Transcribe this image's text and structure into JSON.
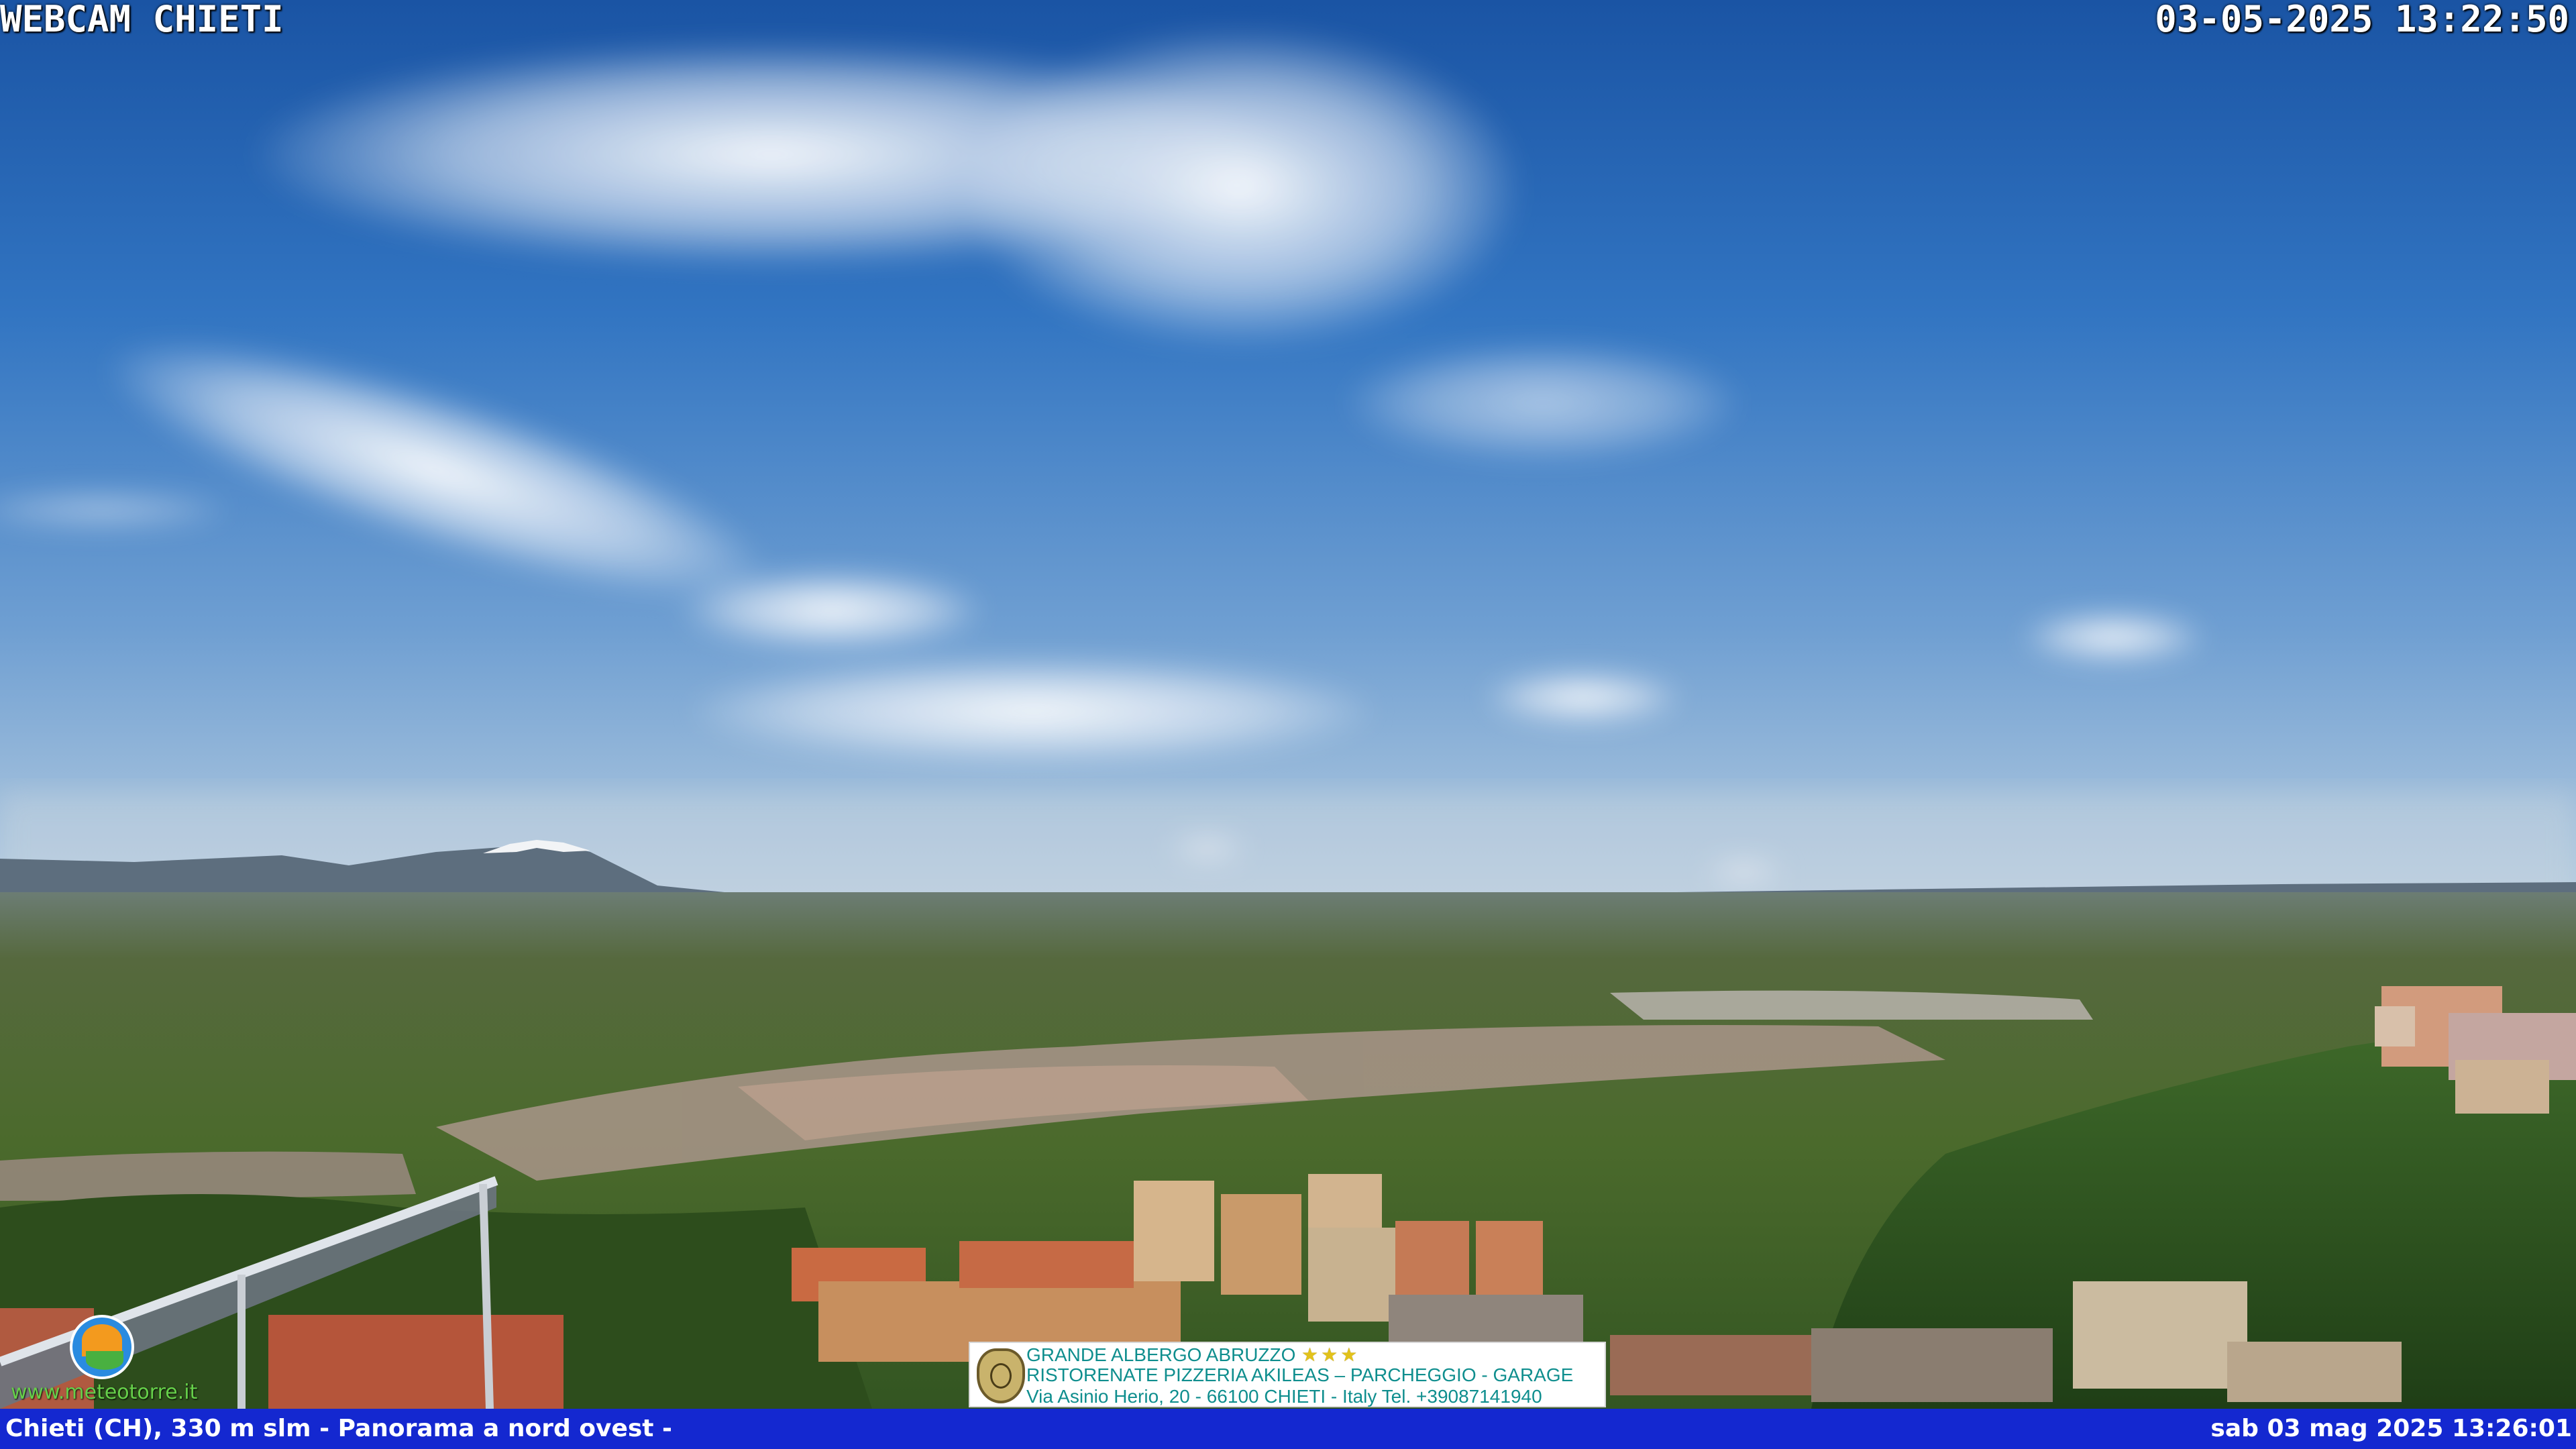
{
  "overlay": {
    "title": "WEBCAM CHIETI",
    "timestamp": "03-05-2025 13:22:50"
  },
  "watermark": {
    "text": "www.meteotorre.it",
    "icon": "sun-leaf-logo-icon"
  },
  "advert": {
    "line1": "GRANDE ALBERGO ABRUZZO",
    "stars": "★★★",
    "line2": "RISTORENATE PIZZERIA AKILEAS – PARCHEGGIO - GARAGE",
    "line3": "Via Asinio Herio, 20 - 66100 CHIETI - Italy Tel. +39087141940",
    "icon": "hotel-crest-icon"
  },
  "footer": {
    "location": "Chieti (CH), 330 m slm - Panorama a nord ovest -",
    "datetime": "sab 03 mag 2025 13:26:01"
  },
  "colors": {
    "footer_bar": "#1428d0",
    "sky_top": "#1d5fae",
    "advert_text": "#0f8e8e"
  }
}
